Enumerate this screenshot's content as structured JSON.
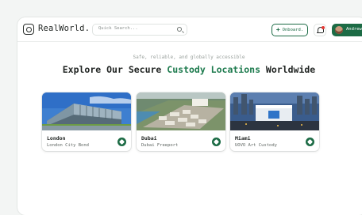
{
  "app": {
    "brand": "RealWorld."
  },
  "search": {
    "placeholder": "Quick Search..."
  },
  "toolbar": {
    "onboard_label": "Onboard.",
    "user_name": "Andrew"
  },
  "hero": {
    "subtitle": "Safe, reliable, and globally accessible",
    "title_start": "Explore Our Secure ",
    "title_accent": "Custody Locations",
    "title_end": " Worldwide"
  },
  "locations": [
    {
      "city": "London",
      "facility": "London City Bond"
    },
    {
      "city": "Dubai",
      "facility": "Dubai Freeport"
    },
    {
      "city": "Miami",
      "facility": "UOVO Art Custody"
    }
  ],
  "colors": {
    "accent": "#1c6b45",
    "notification": "#e53935"
  }
}
